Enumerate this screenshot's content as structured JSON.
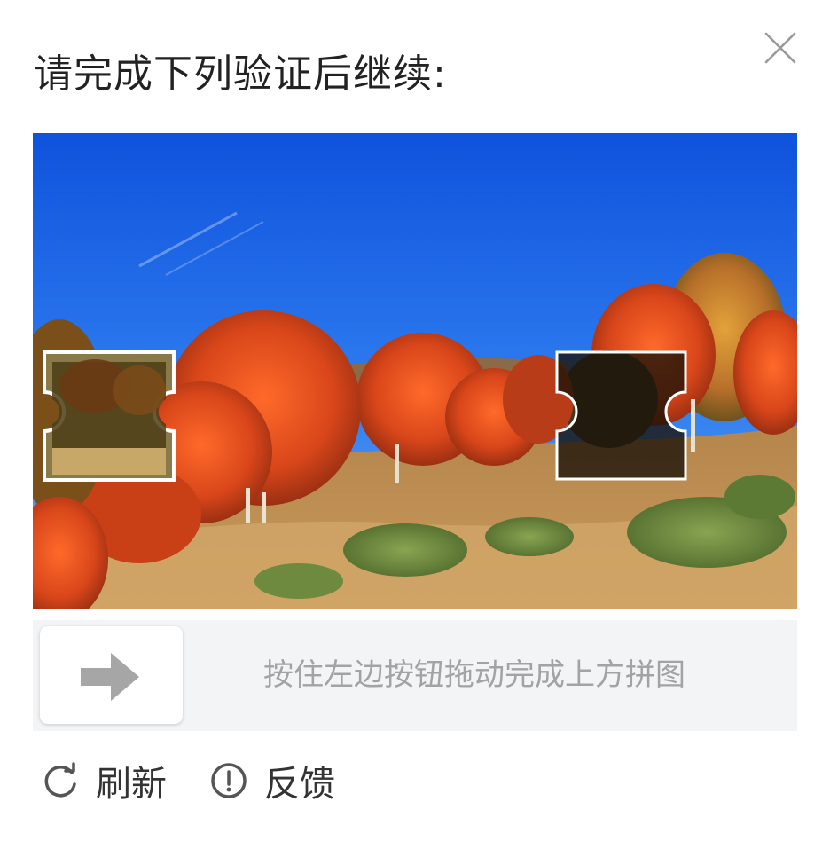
{
  "dialog": {
    "title": "请完成下列验证后继续:",
    "close_icon": "close-icon"
  },
  "captcha": {
    "image": "autumn-trees-landscape",
    "puzzle_piece": "puzzle-piece",
    "puzzle_slot": "puzzle-slot"
  },
  "slider": {
    "handle_icon": "arrow-right-icon",
    "hint": "按住左边按钮拖动完成上方拼图"
  },
  "footer": {
    "refresh_label": "刷新",
    "refresh_icon": "refresh-icon",
    "feedback_label": "反馈",
    "feedback_icon": "alert-circle-icon"
  },
  "colors": {
    "sky": "#1b5fe0",
    "foliage": "#d9501c",
    "track": "#f3f4f6",
    "hint_text": "#a3a3a3"
  }
}
